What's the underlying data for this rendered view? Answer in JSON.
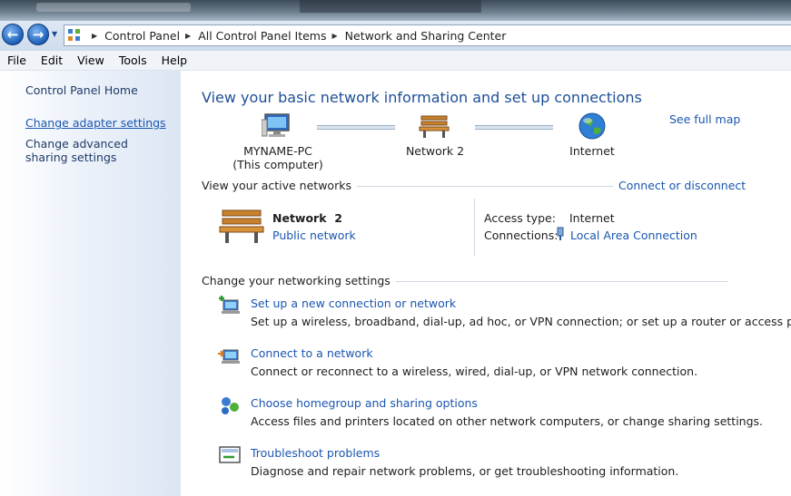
{
  "breadcrumb": [
    "Control Panel",
    "All Control Panel Items",
    "Network and Sharing Center"
  ],
  "menu": [
    "File",
    "Edit",
    "View",
    "Tools",
    "Help"
  ],
  "sidebar": {
    "home": "Control Panel Home",
    "links": [
      {
        "label": "Change adapter settings"
      },
      {
        "label": "Change advanced sharing settings"
      }
    ]
  },
  "main": {
    "heading": "View your basic network information and set up connections",
    "see_full_map": "See full map",
    "map": {
      "computer_name": "MYNAME-PC",
      "computer_sub": "(This computer)",
      "network": "Network  2",
      "internet": "Internet"
    },
    "active_networks": {
      "title": "View your active networks",
      "connect_link": "Connect or disconnect",
      "network_name": "Network  2",
      "network_type": "Public network",
      "access_type_label": "Access type:",
      "access_type_value": "Internet",
      "connections_label": "Connections:",
      "connections_value": "Local Area Connection"
    },
    "settings": {
      "title": "Change your networking settings",
      "tasks": [
        {
          "title": "Set up a new connection or network",
          "desc": "Set up a wireless, broadband, dial-up, ad hoc, or VPN connection; or set up a router or access point."
        },
        {
          "title": "Connect to a network",
          "desc": "Connect or reconnect to a wireless, wired, dial-up, or VPN network connection."
        },
        {
          "title": "Choose homegroup and sharing options",
          "desc": "Access files and printers located on other network computers, or change sharing settings."
        },
        {
          "title": "Troubleshoot problems",
          "desc": "Diagnose and repair network problems, or get troubleshooting information."
        }
      ]
    }
  }
}
